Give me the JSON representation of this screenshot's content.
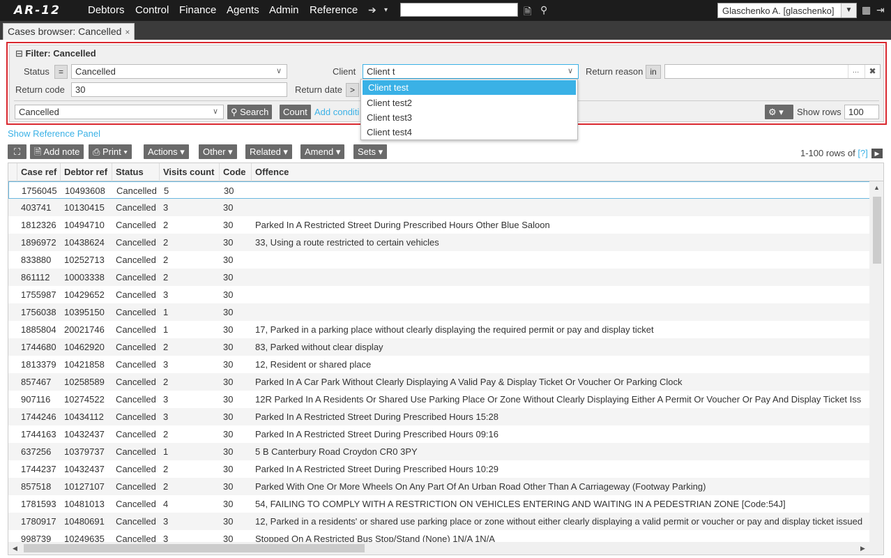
{
  "app": {
    "logo": "AR-12",
    "menu": [
      "Debtors",
      "Control",
      "Finance",
      "Agents",
      "Admin",
      "Reference"
    ],
    "user": "Glaschenko A. [glaschenko]"
  },
  "tab": {
    "title": "Cases browser: Cancelled",
    "close": "×"
  },
  "filter": {
    "title": "Filter: Cancelled",
    "status_label": "Status",
    "status_op": "=",
    "status_value": "Cancelled",
    "client_label": "Client",
    "client_value": "Client t",
    "return_reason_label": "Return reason",
    "return_reason_op": "in",
    "return_code_label": "Return code",
    "return_code_value": "30",
    "return_date_label": "Return date",
    "return_date_op": ">",
    "saved_filter": "Cancelled",
    "search_btn": "Search",
    "count_btn": "Count",
    "add_condition": "Add conditi",
    "show_rows_label": "Show rows",
    "show_rows_value": "100"
  },
  "client_options": [
    "Client test",
    "Client test2",
    "Client test3",
    "Client test4"
  ],
  "show_reference_panel": "Show Reference Panel",
  "toolbar": {
    "add_note": "Add note",
    "print": "Print",
    "actions": "Actions",
    "other": "Other",
    "related": "Related",
    "amend": "Amend",
    "sets": "Sets",
    "rows_info": "1-100 rows of",
    "rows_help": "[?]"
  },
  "columns": [
    "Case ref",
    "Debtor ref",
    "Status",
    "Visits count",
    "Code",
    "Offence"
  ],
  "rows": [
    [
      "1756045",
      "10493608",
      "Cancelled",
      "5",
      "30",
      ""
    ],
    [
      "403741",
      "10130415",
      "Cancelled",
      "3",
      "30",
      ""
    ],
    [
      "1812326",
      "10494710",
      "Cancelled",
      "2",
      "30",
      "Parked In A Restricted Street During Prescribed Hours Other Blue Saloon"
    ],
    [
      "1896972",
      "10438624",
      "Cancelled",
      "2",
      "30",
      "33, Using a route restricted to certain vehicles"
    ],
    [
      "833880",
      "10252713",
      "Cancelled",
      "2",
      "30",
      ""
    ],
    [
      "861112",
      "10003338",
      "Cancelled",
      "2",
      "30",
      ""
    ],
    [
      "1755987",
      "10429652",
      "Cancelled",
      "3",
      "30",
      ""
    ],
    [
      "1756038",
      "10395150",
      "Cancelled",
      "1",
      "30",
      ""
    ],
    [
      "1885804",
      "20021746",
      "Cancelled",
      "1",
      "30",
      "17, Parked in a parking place without clearly displaying the required permit or pay and display ticket"
    ],
    [
      "1744680",
      "10462920",
      "Cancelled",
      "2",
      "30",
      "83, Parked without clear display"
    ],
    [
      "1813379",
      "10421858",
      "Cancelled",
      "3",
      "30",
      "12, Resident or shared place"
    ],
    [
      "857467",
      "10258589",
      "Cancelled",
      "2",
      "30",
      "Parked In A Car Park Without Clearly Displaying A Valid Pay & Display Ticket Or Voucher Or Parking Clock"
    ],
    [
      "907116",
      "10274522",
      "Cancelled",
      "3",
      "30",
      "12R Parked In A Residents Or Shared Use Parking Place Or Zone Without Clearly Displaying Either A Permit Or Voucher Or Pay And Display Ticket Iss"
    ],
    [
      "1744246",
      "10434112",
      "Cancelled",
      "3",
      "30",
      "Parked In A Restricted Street During Prescribed Hours 15:28"
    ],
    [
      "1744163",
      "10432437",
      "Cancelled",
      "2",
      "30",
      "Parked In A Restricted Street During Prescribed Hours 09:16"
    ],
    [
      "637256",
      "10379737",
      "Cancelled",
      "1",
      "30",
      "5 B Canterbury Road Croydon CR0 3PY"
    ],
    [
      "1744237",
      "10432437",
      "Cancelled",
      "2",
      "30",
      "Parked In A Restricted Street During Prescribed Hours 10:29"
    ],
    [
      "857518",
      "10127107",
      "Cancelled",
      "2",
      "30",
      "Parked With One Or More Wheels On Any Part Of An Urban Road Other Than A Carriageway (Footway Parking)"
    ],
    [
      "1781593",
      "10481013",
      "Cancelled",
      "4",
      "30",
      "54, FAILING TO COMPLY WITH A RESTRICTION ON VEHICLES ENTERING AND WAITING IN A PEDESTRIAN ZONE [Code:54J]"
    ],
    [
      "1780917",
      "10480691",
      "Cancelled",
      "3",
      "30",
      "12, Parked in a residents' or shared use parking place or zone without either clearly displaying a valid permit or voucher or pay and display ticket issued"
    ],
    [
      "998739",
      "10249635",
      "Cancelled",
      "3",
      "30",
      "Stopped On A Restricted Bus Stop/Stand (None) 1N/A 1N/A"
    ]
  ]
}
